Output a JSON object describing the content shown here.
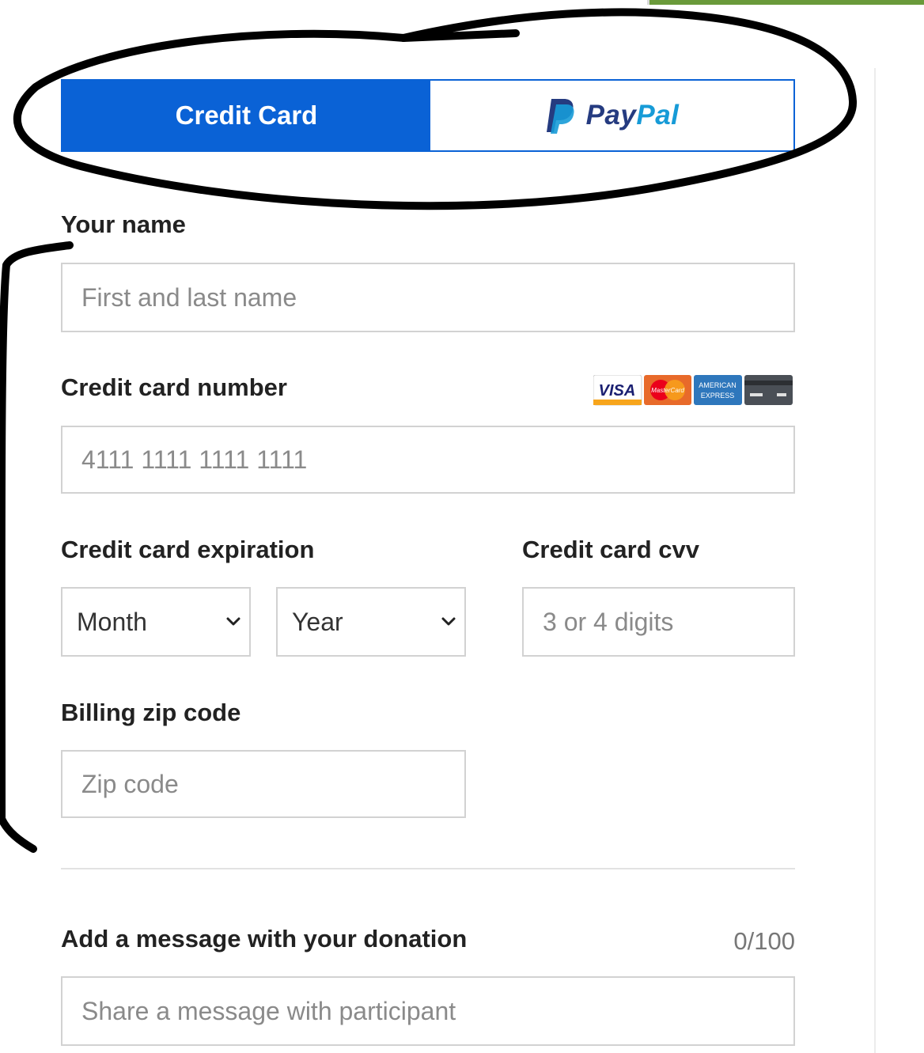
{
  "tabs": {
    "credit_card": "Credit Card",
    "paypal_pay": "Pay",
    "paypal_pal": "Pal",
    "active": "credit_card"
  },
  "form": {
    "name": {
      "label": "Your name",
      "placeholder": "First and last name"
    },
    "card_number": {
      "label": "Credit card number",
      "placeholder": "4111 1111 1111 1111"
    },
    "expiration": {
      "label": "Credit card expiration",
      "month": "Month",
      "year": "Year"
    },
    "cvv": {
      "label": "Credit card cvv",
      "placeholder": "3 or 4 digits"
    },
    "zip": {
      "label": "Billing zip code",
      "placeholder": "Zip code"
    },
    "message": {
      "label": "Add a message with your donation",
      "counter": "0/100",
      "placeholder": "Share a message with participant"
    }
  },
  "card_logos": {
    "visa": "VISA",
    "mastercard": "MasterCard",
    "amex_line1": "AMERICAN",
    "amex_line2": "EXPRESS"
  },
  "colors": {
    "primary": "#0a62d6",
    "paypal_dark": "#253b80",
    "paypal_light": "#179bd7",
    "annotation": "#000000"
  }
}
